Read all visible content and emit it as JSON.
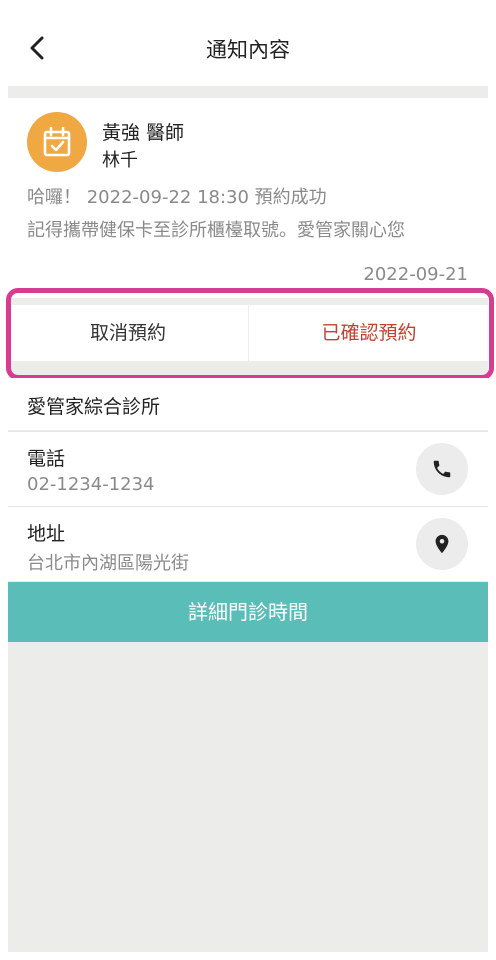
{
  "header": {
    "title": "通知內容",
    "back_icon": "chevron-left-icon"
  },
  "notification": {
    "icon": "calendar-check-icon",
    "icon_color": "#f0a842",
    "doctor": "黃強 醫師",
    "patient": "林千",
    "message_prefix": "哈囉！",
    "message_datetime": "2022-09-22 18:30",
    "message_suffix": "預約成功",
    "message_line2": "記得攜帶健保卡至診所櫃檯取號。愛管家關心您",
    "date": "2022-09-21"
  },
  "actions": {
    "cancel_label": "取消預約",
    "confirm_label": "已確認預約",
    "confirm_color": "#c2412f",
    "highlight_color": "#d63c8f"
  },
  "clinic": {
    "name": "愛管家綜合診所",
    "phone_label": "電話",
    "phone_value": "02-1234-1234",
    "phone_icon": "phone-icon",
    "address_label": "地址",
    "address_value": "台北市內湖區陽光街",
    "address_icon": "map-pin-icon"
  },
  "cta": {
    "label": "詳細門診時間",
    "color": "#5bbdb8"
  }
}
